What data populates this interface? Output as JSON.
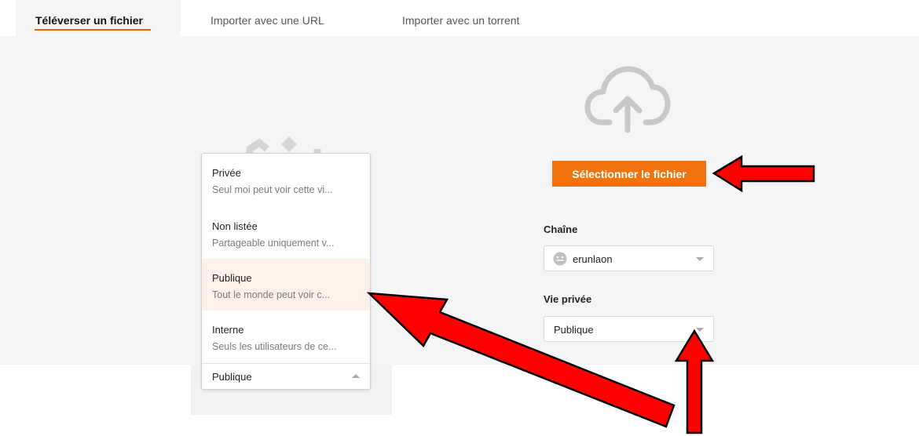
{
  "tabs": {
    "upload": "Téléverser un fichier",
    "url": "Importer avec une URL",
    "torrent": "Importer avec un torrent"
  },
  "upload": {
    "button_label": "Sélectionner le fichier"
  },
  "channel": {
    "label": "Chaîne",
    "value": "erunlaon"
  },
  "privacy": {
    "label": "Vie privée",
    "value": "Publique"
  },
  "privacy_menu": {
    "options": [
      {
        "title": "Privée",
        "desc": "Seul moi peut voir cette vi..."
      },
      {
        "title": "Non listée",
        "desc": "Partageable uniquement v..."
      },
      {
        "title": "Publique",
        "desc": "Tout le monde peut voir c..."
      },
      {
        "title": "Interne",
        "desc": "Seuls les utilisateurs de ce..."
      }
    ],
    "selected": "Publique",
    "highlight_color": "#fdf1ea"
  },
  "colors": {
    "accent": "#f1730f",
    "annotation_arrow": "#ff0000"
  },
  "icons": [
    "cloud-upload-icon",
    "avatar-icon",
    "chevron-down-icon",
    "chevron-up-icon"
  ]
}
